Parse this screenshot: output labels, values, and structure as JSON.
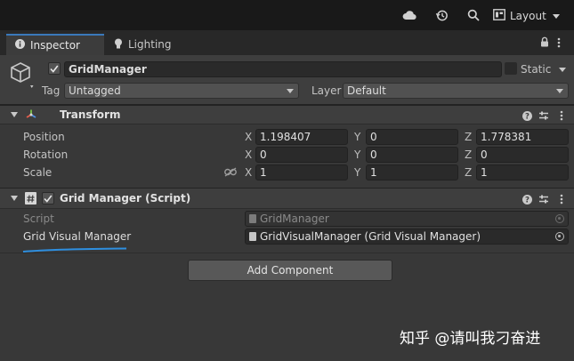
{
  "toolbar": {
    "cloud_icon": "cloud-icon",
    "history_icon": "history-icon",
    "search_icon": "search-icon",
    "layout_label": "Layout"
  },
  "tabs": [
    {
      "label": "Inspector",
      "icon": "info-icon",
      "active": true
    },
    {
      "label": "Lighting",
      "icon": "lightbulb-icon",
      "active": false
    }
  ],
  "gameobject": {
    "name": "GridManager",
    "active": true,
    "static_label": "Static",
    "tag_label": "Tag",
    "tag_value": "Untagged",
    "layer_label": "Layer",
    "layer_value": "Default"
  },
  "transform": {
    "title": "Transform",
    "axis_labels": [
      "X",
      "Y",
      "Z"
    ],
    "rows": [
      {
        "label": "Position",
        "x": "1.198407",
        "y": "0",
        "z": "1.778381"
      },
      {
        "label": "Rotation",
        "x": "0",
        "y": "0",
        "z": "0"
      },
      {
        "label": "Scale",
        "x": "1",
        "y": "1",
        "z": "1"
      }
    ]
  },
  "grid_manager": {
    "title": "Grid Manager (Script)",
    "enabled": true,
    "script_label": "Script",
    "script_value": "GridManager",
    "field_label": "Grid Visual Manager",
    "field_value": "GridVisualManager (Grid Visual Manager)"
  },
  "add_component_label": "Add Component",
  "watermark": "知乎 @请叫我刁奋进",
  "colors": {
    "accent": "#3a79bb",
    "underline": "#2e8fe0",
    "panel": "#383838",
    "topbar": "#191919"
  }
}
